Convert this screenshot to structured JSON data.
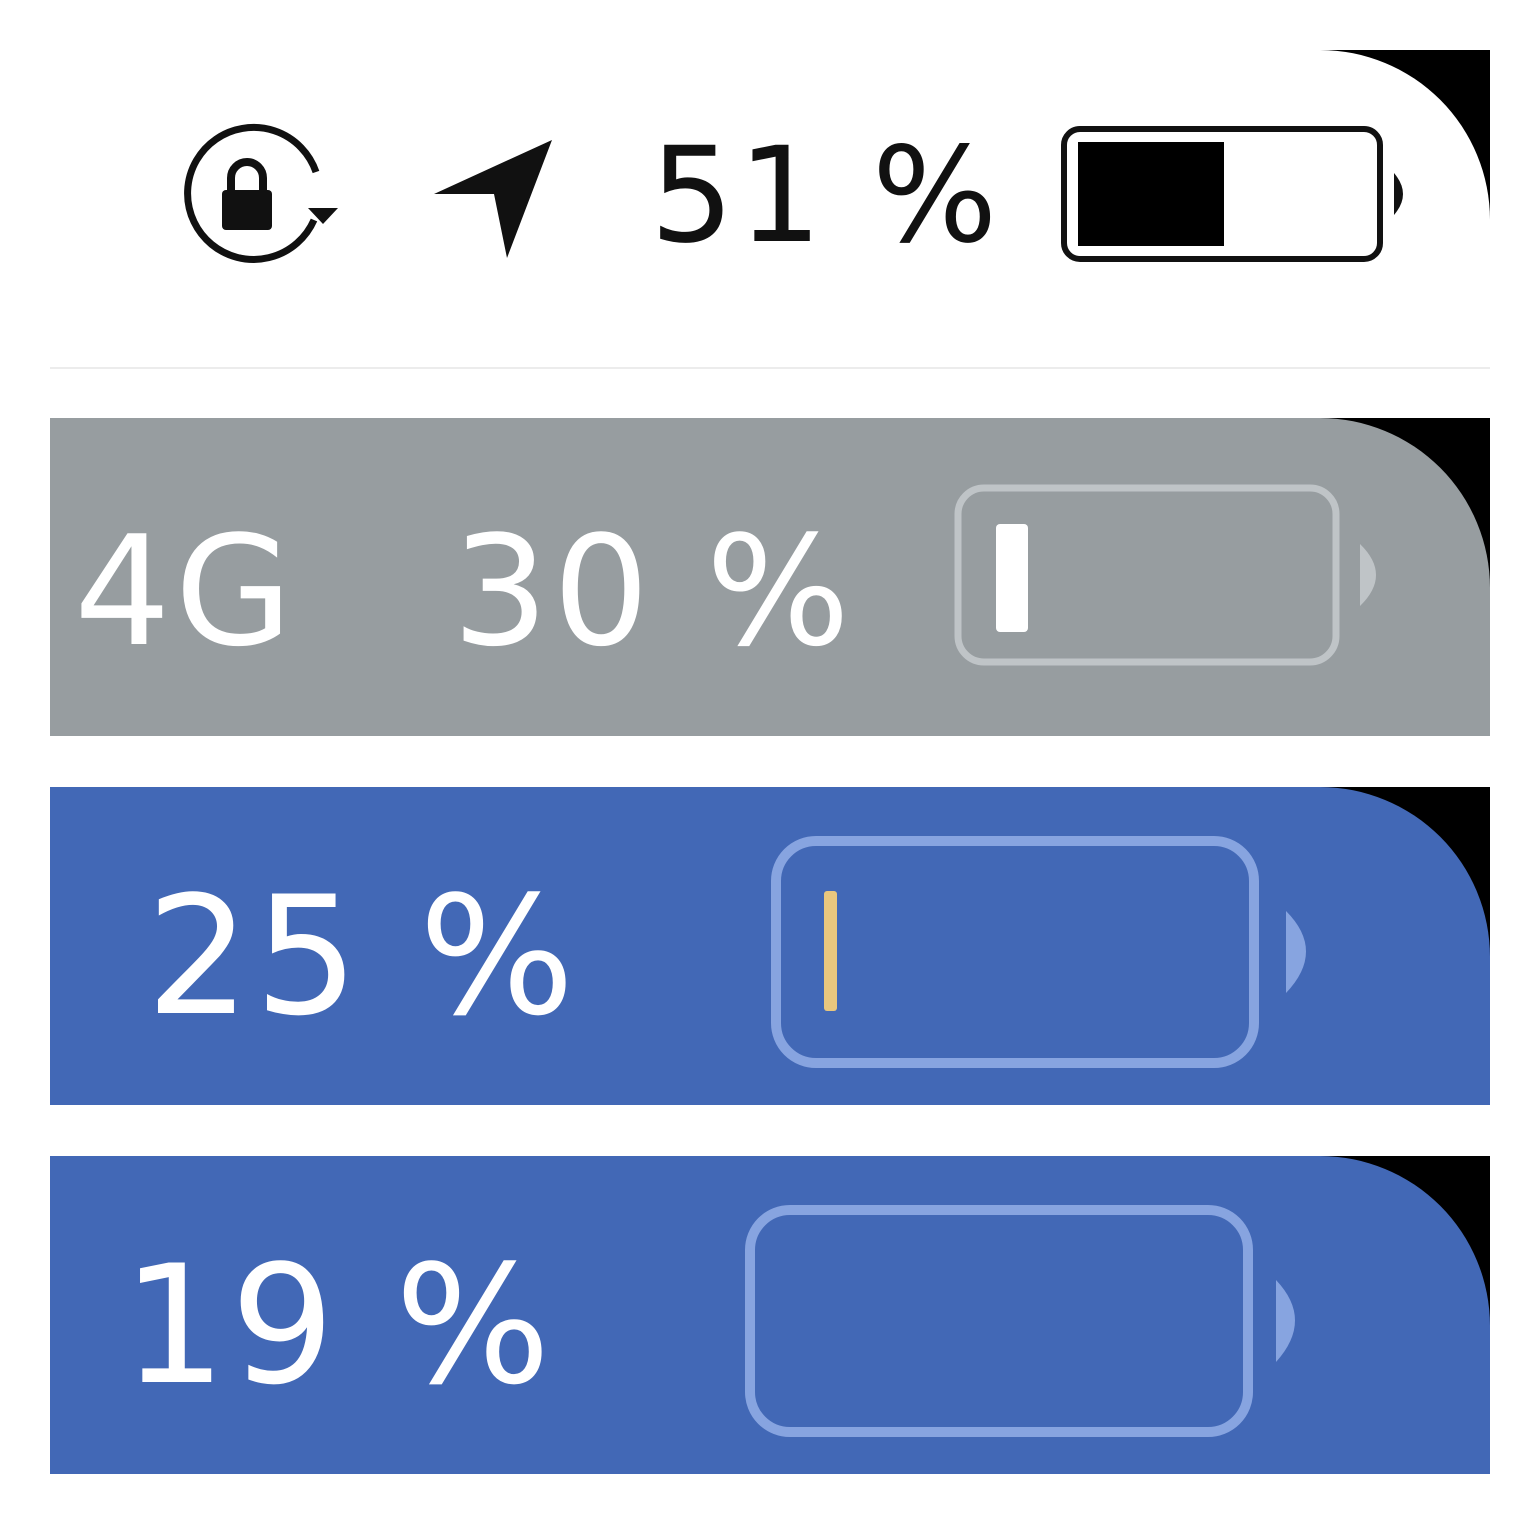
{
  "panels": [
    {
      "theme": "light",
      "icons": [
        "orientation-lock-icon",
        "location-arrow-icon"
      ],
      "battery_text": "51 %",
      "battery_level": 0.51,
      "colors": {
        "bg": "#ffffff",
        "text": "#111111",
        "fill": "#000000",
        "outline": "#111111"
      }
    },
    {
      "theme": "gray",
      "network": "4G",
      "battery_text": "30 %",
      "battery_level": 0.1,
      "colors": {
        "bg": "#979da0",
        "text": "#ffffff",
        "fill": "#ffffff",
        "outline": "#bfc4c7"
      }
    },
    {
      "theme": "blue",
      "battery_text": "25 %",
      "battery_level": 0.03,
      "colors": {
        "bg": "#4268b6",
        "text": "#ffffff",
        "fill": "#e9c77e",
        "outline": "#87a4e0"
      }
    },
    {
      "theme": "blue",
      "battery_text": "19 %",
      "battery_level": 0.0,
      "colors": {
        "bg": "#4268b6",
        "text": "#ffffff",
        "fill": "#e9c77e",
        "outline": "#87a4e0"
      }
    }
  ]
}
